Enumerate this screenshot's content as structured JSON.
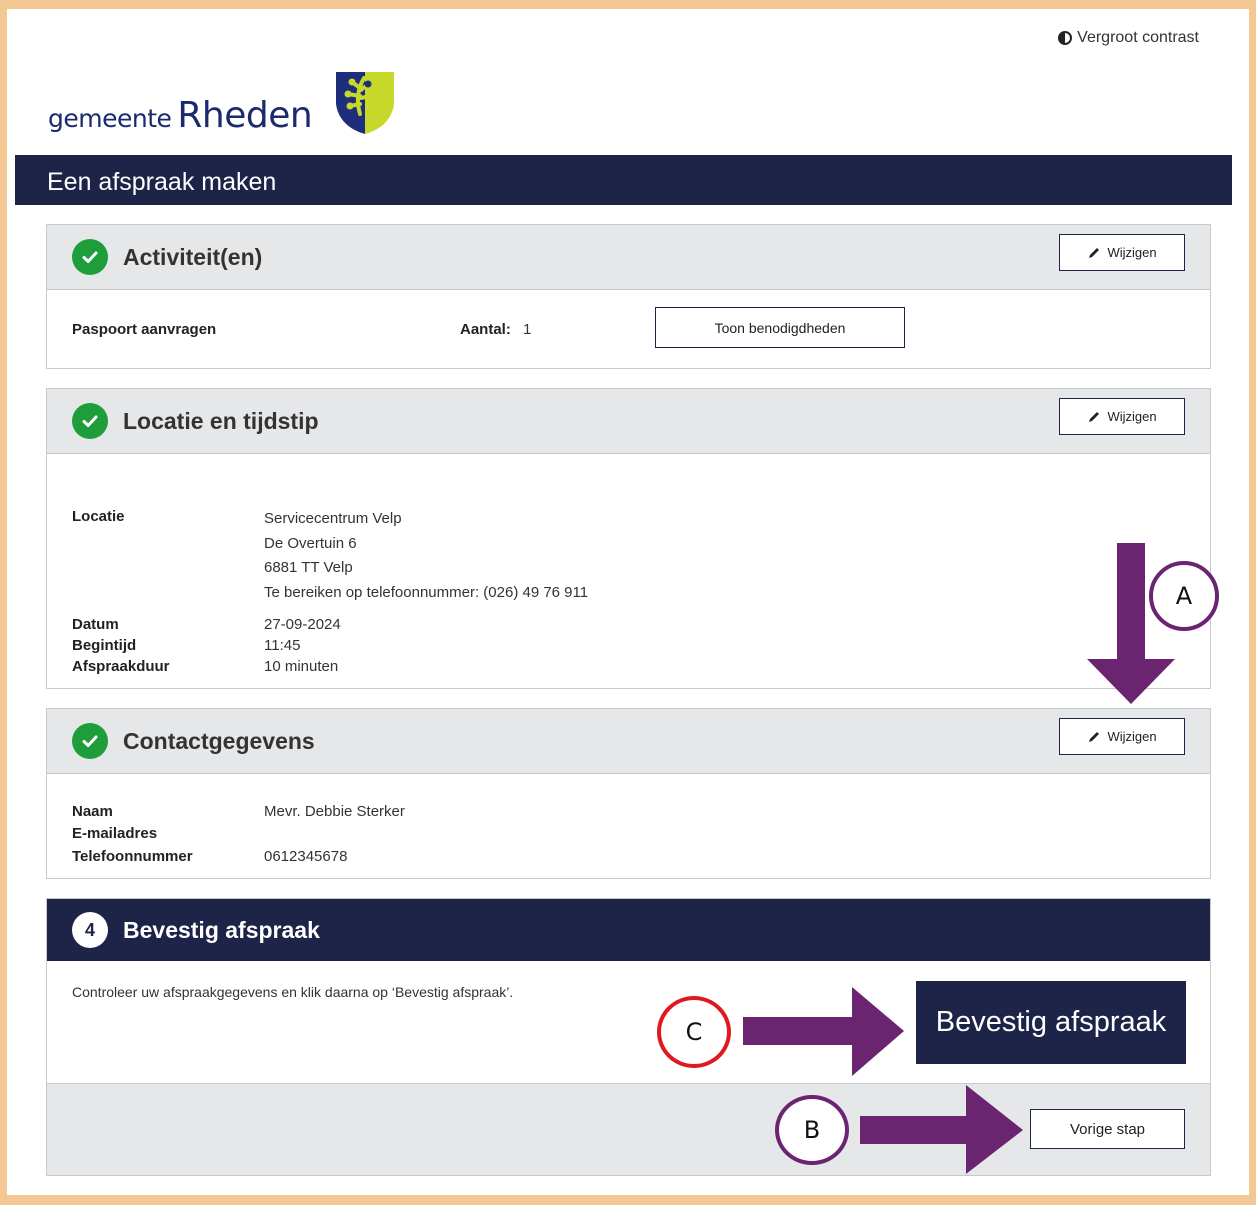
{
  "header": {
    "contrast_label": "Vergroot contrast",
    "logo_prefix": "gemeente",
    "logo_name": "Rheden",
    "page_title": "Een afspraak maken"
  },
  "steps": {
    "edit_label": "Wijzigen",
    "activities": {
      "title": "Activiteit(en)",
      "item": "Paspoort aanvragen",
      "count_label": "Aantal:",
      "count_value": "1",
      "requirements_button": "Toon benodigdheden"
    },
    "location": {
      "title": "Locatie en tijdstip",
      "location_label": "Locatie",
      "location_lines": [
        "Servicecentrum Velp",
        "De Overtuin 6",
        "6881 TT Velp",
        "Te bereiken op telefoonnummer: (026) 49 76 911"
      ],
      "date_label": "Datum",
      "date_value": "27-09-2024",
      "start_label": "Begintijd",
      "start_value": "11:45",
      "duration_label": "Afspraakduur",
      "duration_value": "10 minuten"
    },
    "contact": {
      "title": "Contactgegevens",
      "name_label": "Naam",
      "name_value": "Mevr. Debbie Sterker",
      "email_label": "E-mailadres",
      "email_value": "",
      "phone_label": "Telefoonnummer",
      "phone_value": "0612345678"
    },
    "confirm": {
      "number": "4",
      "title": "Bevestig afspraak",
      "instruction": "Controleer uw afspraakgegevens en klik daarna op ‘Bevestig afspraak’.",
      "confirm_button": "Bevestig afspraak",
      "back_button": "Vorige stap"
    }
  },
  "annotations": {
    "a": "A",
    "b": "B",
    "c": "C",
    "arrow_color": "#6b2470",
    "c_circle_color": "#e0191f"
  },
  "colors": {
    "navy": "#1d2448",
    "success": "#1e9e3a",
    "frame": "#f4c893"
  }
}
